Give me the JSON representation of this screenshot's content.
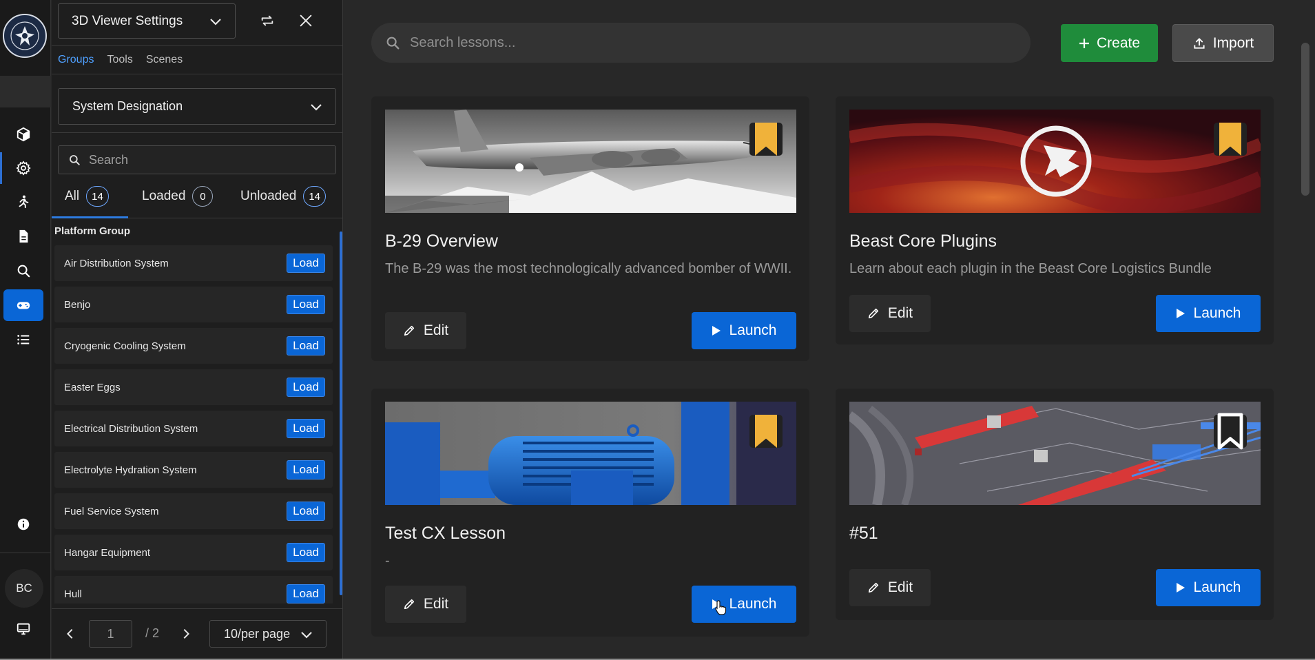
{
  "app": {
    "avatar_initials": "BC"
  },
  "panel": {
    "viewer_select": "3D Viewer Settings",
    "tabs": [
      {
        "label": "Groups"
      },
      {
        "label": "Tools"
      },
      {
        "label": "Scenes"
      }
    ],
    "group_select": "System Designation",
    "search_placeholder": "Search",
    "filters": {
      "all_label": "All",
      "all_count": "14",
      "loaded_label": "Loaded",
      "loaded_count": "0",
      "unloaded_label": "Unloaded",
      "unloaded_count": "14"
    },
    "list_header": "Platform Group",
    "items": [
      {
        "name": "Air Distribution System",
        "action": "Load"
      },
      {
        "name": "Benjo",
        "action": "Load"
      },
      {
        "name": "Cryogenic Cooling System",
        "action": "Load"
      },
      {
        "name": "Easter Eggs",
        "action": "Load"
      },
      {
        "name": "Electrical Distribution System",
        "action": "Load"
      },
      {
        "name": "Electrolyte Hydration System",
        "action": "Load"
      },
      {
        "name": "Fuel Service System",
        "action": "Load"
      },
      {
        "name": "Hangar Equipment",
        "action": "Load"
      },
      {
        "name": "Hull",
        "action": "Load"
      }
    ],
    "pager": {
      "page": "1",
      "total": "/ 2",
      "page_size": "10/per page"
    }
  },
  "main": {
    "search_placeholder": "Search lessons...",
    "create_label": "Create",
    "import_label": "Import",
    "lessons": [
      {
        "title": "B-29 Overview",
        "description": "The B-29 was the most technologically advanced bomber of WWII.",
        "edit": "Edit",
        "launch": "Launch",
        "bookmarked": true
      },
      {
        "title": "Beast Core Plugins",
        "description": "Learn about each plugin in the Beast Core Logistics Bundle",
        "edit": "Edit",
        "launch": "Launch",
        "bookmarked": true
      },
      {
        "title": "Test CX Lesson",
        "description": "-",
        "edit": "Edit",
        "launch": "Launch",
        "bookmarked": true
      },
      {
        "title": "#51",
        "description": "",
        "edit": "Edit",
        "launch": "Launch",
        "bookmarked": false
      }
    ]
  },
  "colors": {
    "accent_blue": "#0a66d6",
    "create_green": "#1f8c3b",
    "bookmark_gold": "#f0b23a",
    "background": "#282828"
  },
  "icons": [
    "cube-icon",
    "gear-icon",
    "walker-icon",
    "document-icon",
    "search-icon",
    "gamepad-icon",
    "list-icon",
    "info-icon",
    "monitor-icon",
    "refresh-icon",
    "close-icon",
    "chevron-down-icon",
    "plus-icon",
    "upload-icon",
    "bookmark-icon",
    "pencil-icon",
    "play-icon"
  ]
}
